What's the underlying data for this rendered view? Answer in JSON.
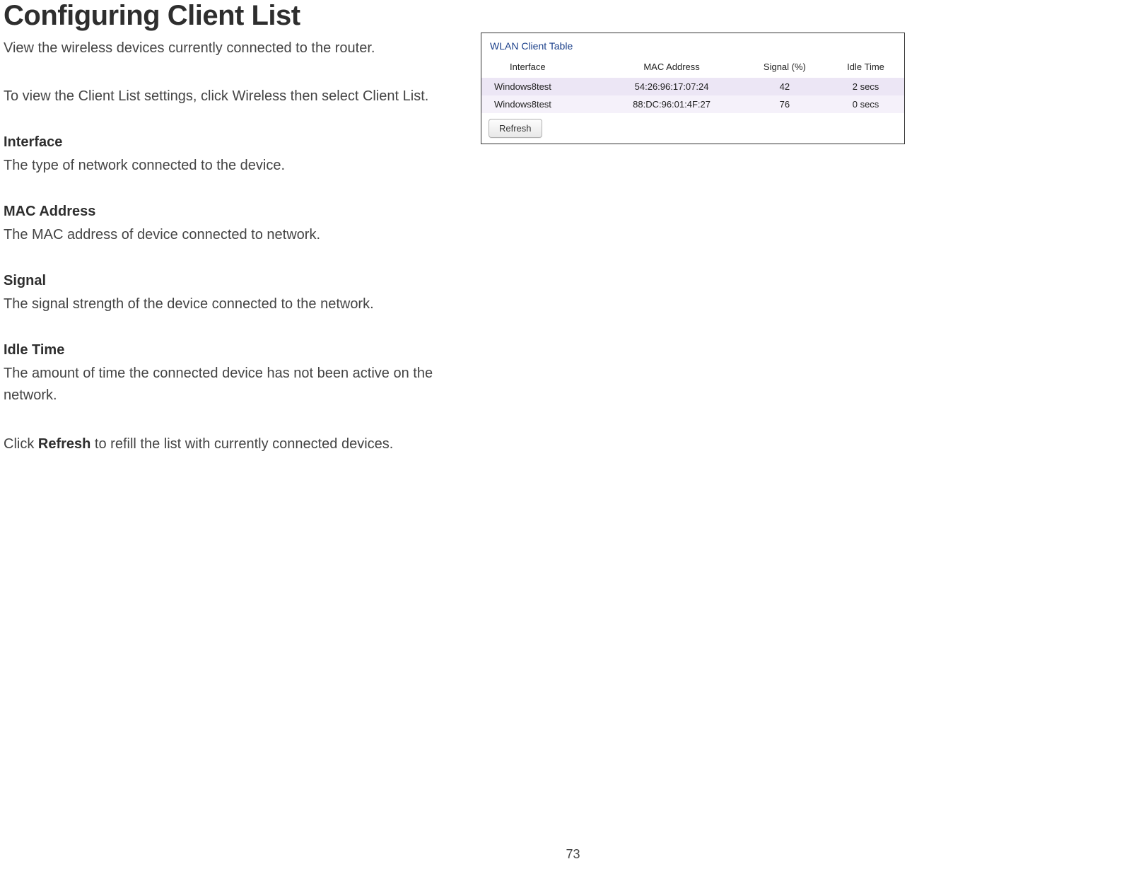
{
  "page": {
    "title": "Configuring Client List",
    "intro": "View the wireless devices currently connected to the router.",
    "navText": "To view the Client List settings, click Wireless then select Client List.",
    "pageNumber": "73"
  },
  "fields": [
    {
      "heading": "Interface",
      "desc": "The type of network connected to the device."
    },
    {
      "heading": "MAC Address",
      "desc": "The MAC address of device connected to network."
    },
    {
      "heading": "Signal",
      "desc": "The signal strength of the device connected to the network."
    },
    {
      "heading": "Idle Time",
      "desc": "The amount of time the connected device has not been active on the network."
    }
  ],
  "refreshLine": {
    "prefix": "Click ",
    "bold": "Refresh",
    "suffix": " to refill the list with currently connected devices."
  },
  "tablePanel": {
    "title": "WLAN Client Table",
    "headers": {
      "interface": "Interface",
      "mac": "MAC Address",
      "signal": "Signal (%)",
      "idle": "Idle Time"
    },
    "rows": [
      {
        "interface": "Windows8test",
        "mac": "54:26:96:17:07:24",
        "signal": "42",
        "idle": "2 secs"
      },
      {
        "interface": "Windows8test",
        "mac": "88:DC:96:01:4F:27",
        "signal": "76",
        "idle": "0 secs"
      }
    ],
    "refreshButton": "Refresh"
  }
}
